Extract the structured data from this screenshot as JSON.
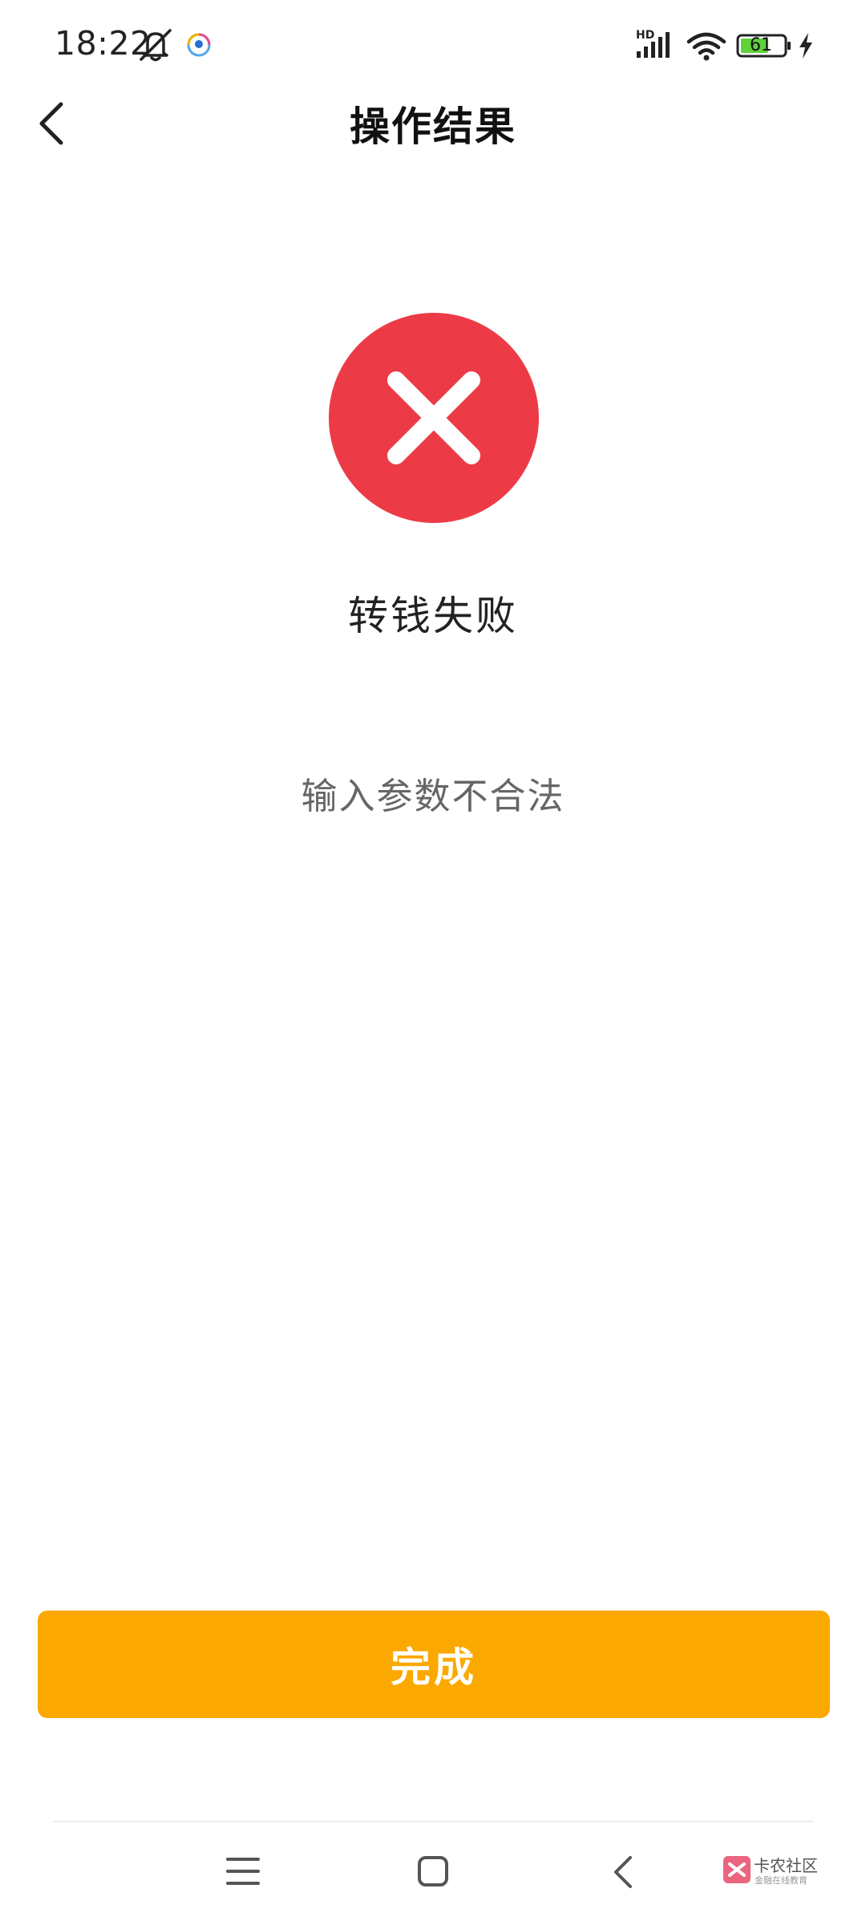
{
  "status_bar": {
    "time": "18:22",
    "network_label": "HD",
    "battery_level": "61",
    "icons": [
      "bell-off-icon",
      "app-notification-icon",
      "signal-icon",
      "wifi-icon",
      "battery-icon",
      "charging-icon"
    ]
  },
  "header": {
    "title": "操作结果",
    "back_icon": "chevron-left-icon"
  },
  "result": {
    "status": "failure",
    "icon": "close-circle-icon",
    "title": "转钱失败",
    "message": "输入参数不合法"
  },
  "actions": {
    "done_label": "完成"
  },
  "nav_bar": {
    "icons": [
      "menu-icon",
      "home-icon",
      "back-icon"
    ]
  },
  "watermark": {
    "name": "卡农社区",
    "tagline": "金融在线教育"
  },
  "colors": {
    "error_red": "#ec3b47",
    "button_orange": "#fba900",
    "battery_green": "#5fd13b",
    "background": "#ffffff"
  }
}
